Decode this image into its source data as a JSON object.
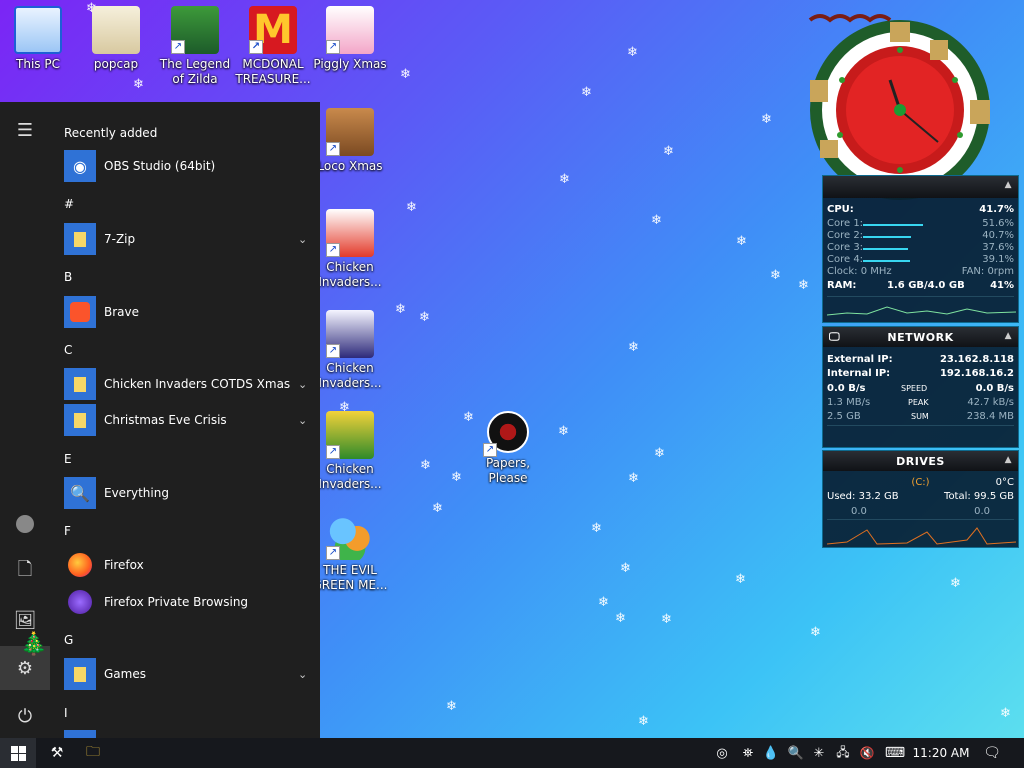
{
  "desktop": {
    "icons": [
      {
        "label": "This PC"
      },
      {
        "label": "popcap"
      },
      {
        "label": "The Legend of Zilda"
      },
      {
        "label": "MCDONAL TREASURE..."
      },
      {
        "label": "Piggly Xmas"
      },
      {
        "label": "Loco Xmas"
      },
      {
        "label": "Chicken Invaders..."
      },
      {
        "label": "Chicken Invaders..."
      },
      {
        "label": "Chicken Invaders..."
      },
      {
        "label": "THE EVIL GREEN ME..."
      },
      {
        "label": "Papers, Please"
      }
    ]
  },
  "start_menu": {
    "header": "Recently added",
    "recent": {
      "label": "OBS Studio (64bit)"
    },
    "sections": [
      {
        "letter": "#",
        "items": [
          {
            "label": "7-Zip",
            "expandable": true
          }
        ]
      },
      {
        "letter": "B",
        "items": [
          {
            "label": "Brave",
            "expandable": false
          }
        ]
      },
      {
        "letter": "C",
        "items": [
          {
            "label": "Chicken Invaders COTDS Xmas",
            "expandable": true
          },
          {
            "label": "Christmas Eve Crisis",
            "expandable": true
          }
        ]
      },
      {
        "letter": "E",
        "items": [
          {
            "label": "Everything",
            "expandable": false
          }
        ]
      },
      {
        "letter": "F",
        "items": [
          {
            "label": "Firefox",
            "expandable": false
          },
          {
            "label": "Firefox Private Browsing",
            "expandable": false
          }
        ]
      },
      {
        "letter": "G",
        "items": [
          {
            "label": "Games",
            "expandable": true
          }
        ]
      },
      {
        "letter": "I",
        "items": []
      }
    ]
  },
  "system_monitor": {
    "cpu": {
      "label": "CPU:",
      "value": "41.7%"
    },
    "cores": [
      {
        "label": "Core 1:",
        "value": "51.6%",
        "level": 0.516
      },
      {
        "label": "Core 2:",
        "value": "40.7%",
        "level": 0.407
      },
      {
        "label": "Core 3:",
        "value": "37.6%",
        "level": 0.376
      },
      {
        "label": "Core 4:",
        "value": "39.1%",
        "level": 0.391
      }
    ],
    "clock": "Clock: 0 MHz",
    "fan": "FAN: 0rpm",
    "ram_label": "RAM:",
    "ram": "1.6 GB/4.0 GB",
    "ram_pct": "41%"
  },
  "network": {
    "title": "NETWORK",
    "external_ip_label": "External IP:",
    "external_ip": "23.162.8.118",
    "internal_ip_label": "Internal IP:",
    "internal_ip": "192.168.16.2",
    "speed_left": "0.0 B/s",
    "speed_label": "SPEED",
    "speed_right": "0.0 B/s",
    "peak_left": "1.3 MB/s",
    "peak_label": "PEAK",
    "peak_right": "42.7 kB/s",
    "sum_left": "2.5 GB",
    "sum_label": "SUM",
    "sum_right": "238.4 MB"
  },
  "drives": {
    "title": "DRIVES",
    "drive": "(C:)",
    "temp": "0°C",
    "used": "Used: 33.2 GB",
    "total": "Total: 99.5 GB",
    "read": "0.0",
    "write": "0.0"
  },
  "taskbar": {
    "time": "11:20 AM"
  },
  "colors": {
    "start_bg": "#1f1f1f",
    "taskbar_bg": "#16181d",
    "accent_blue": "#2f72d6",
    "widget_bg": "#081e32"
  }
}
